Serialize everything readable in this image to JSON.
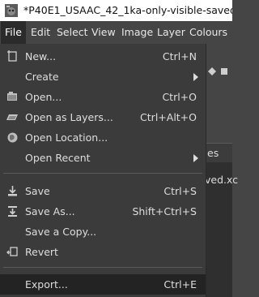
{
  "window": {
    "title": "*P40E1_USAAC_42_1ka-only-visible-saved.xcf-1.0"
  },
  "menubar": {
    "items": [
      "File",
      "Edit",
      "Select",
      "View",
      "Image",
      "Layer",
      "Colours"
    ],
    "active": "File"
  },
  "background": {
    "tab_text": "es",
    "doc_name": "ved.xc"
  },
  "file_menu": {
    "entries": [
      {
        "label": "New...",
        "accel": "Ctrl+N",
        "icon": "new-image-icon"
      },
      {
        "label": "Create",
        "accel": "",
        "icon": "",
        "submenu": true
      },
      {
        "label": "Open...",
        "accel": "Ctrl+O",
        "icon": "open-folder-icon"
      },
      {
        "label": "Open as Layers...",
        "accel": "Ctrl+Alt+O",
        "icon": "open-as-layers-icon"
      },
      {
        "label": "Open Location...",
        "accel": "",
        "icon": "globe-icon"
      },
      {
        "label": "Open Recent",
        "accel": "",
        "icon": "",
        "submenu": true
      },
      {
        "label": "Save",
        "accel": "Ctrl+S",
        "icon": "save-icon"
      },
      {
        "label": "Save As...",
        "accel": "Shift+Ctrl+S",
        "icon": "save-as-icon"
      },
      {
        "label": "Save a Copy...",
        "accel": "",
        "icon": ""
      },
      {
        "label": "Revert",
        "accel": "",
        "icon": "revert-icon"
      },
      {
        "label": "Export...",
        "accel": "Ctrl+E",
        "icon": "",
        "highlighted": true
      }
    ]
  }
}
